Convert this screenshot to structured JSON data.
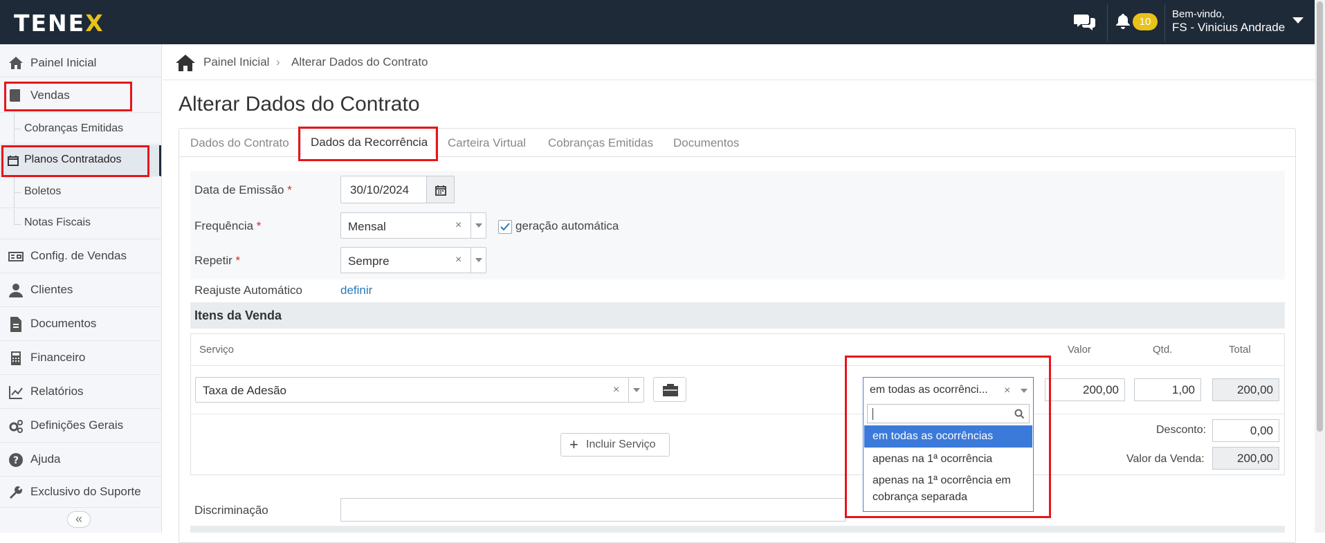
{
  "header": {
    "logo_text_a": "TENE",
    "logo_text_b": "X",
    "notifications": "10",
    "welcome": "Bem-vindo,",
    "user": "FS - Vinicius Andrade"
  },
  "sidebar": {
    "items": [
      {
        "label": "Painel Inicial",
        "icon": "home-icon"
      },
      {
        "label": "Vendas",
        "icon": "book-icon"
      },
      {
        "label": "Cobranças Emitidas"
      },
      {
        "label": "Planos Contratados",
        "icon": "calendar-icon"
      },
      {
        "label": "Boletos"
      },
      {
        "label": "Notas Fiscais"
      },
      {
        "label": "Config. de Vendas",
        "icon": "money-icon"
      },
      {
        "label": "Clientes",
        "icon": "user-icon"
      },
      {
        "label": "Documentos",
        "icon": "document-icon"
      },
      {
        "label": "Financeiro",
        "icon": "calculator-icon"
      },
      {
        "label": "Relatórios",
        "icon": "chart-icon"
      },
      {
        "label": "Definições Gerais",
        "icon": "gears-icon"
      },
      {
        "label": "Ajuda",
        "icon": "question-icon"
      },
      {
        "label": "Exclusivo do Suporte",
        "icon": "wrench-icon"
      }
    ],
    "collapse": "«"
  },
  "breadcrumb": {
    "home": "Painel Inicial",
    "separator": "›",
    "current": "Alterar Dados do Contrato"
  },
  "page_title": "Alterar Dados do Contrato",
  "tabs": [
    {
      "label": "Dados do Contrato"
    },
    {
      "label": "Dados da Recorrência"
    },
    {
      "label": "Carteira Virtual"
    },
    {
      "label": "Cobranças Emitidas"
    },
    {
      "label": "Documentos"
    }
  ],
  "form": {
    "emissao_label": "Data de Emissão",
    "emissao_value": "30/10/2024",
    "frequencia_label": "Frequência",
    "frequencia_value": "Mensal",
    "auto_label": "geração automática",
    "repetir_label": "Repetir",
    "repetir_value": "Sempre",
    "reajuste_label": "Reajuste Automático",
    "reajuste_link": "definir",
    "required_mark": "*",
    "clear_mark": "×",
    "discriminacao_label": "Discriminação"
  },
  "itens": {
    "title": "Itens da Venda",
    "headers": {
      "servico": "Serviço",
      "valor": "Valor",
      "qtd": "Qtd.",
      "total": "Total"
    },
    "row": {
      "servico": "Taxa de Adesão",
      "ocorrencia": "em todas as ocorrênci...",
      "valor": "200,00",
      "qtd": "1,00",
      "total": "200,00"
    },
    "add_button": "Incluir Serviço",
    "desconto_label": "Desconto:",
    "desconto_value": "0,00",
    "valor_venda_label": "Valor da Venda:",
    "valor_venda_value": "200,00"
  },
  "occurrence_dropdown": {
    "options": [
      "em todas as ocorrências",
      "apenas na 1ª ocorrência",
      "apenas na 1ª ocorrência em",
      "cobrança separada"
    ]
  },
  "colors": {
    "topbar": "#1e2a38",
    "accent": "#e8c21a",
    "highlight_box": "#e8141a",
    "selected_option": "#3b7ad9",
    "link": "#2a7ab8"
  }
}
